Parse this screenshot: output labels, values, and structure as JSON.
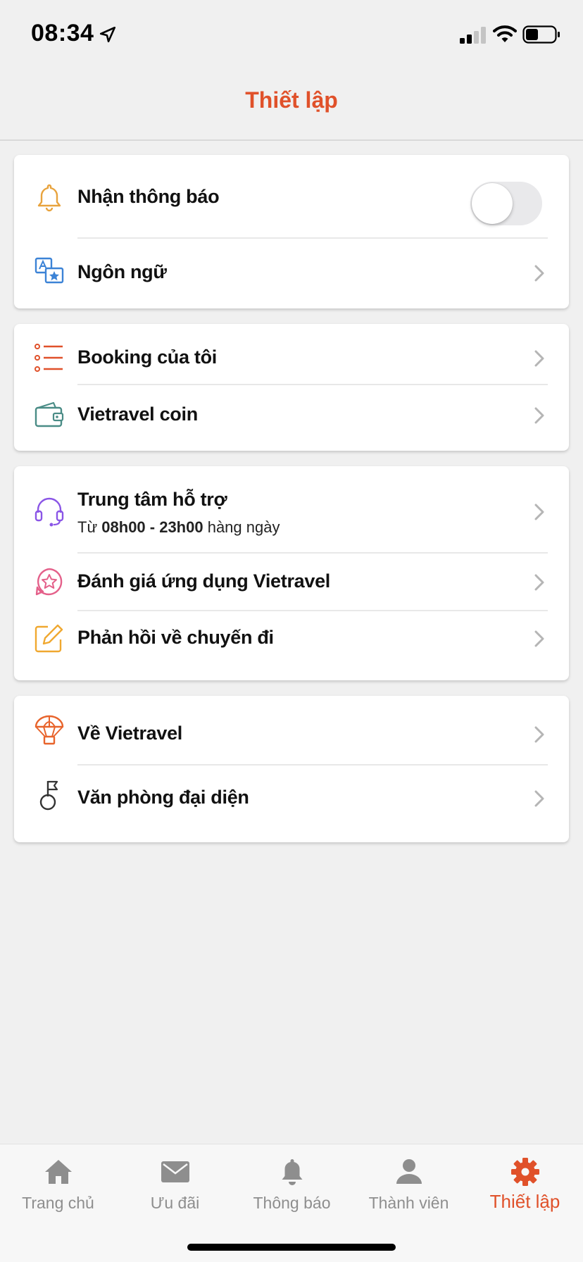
{
  "status_bar": {
    "time": "08:34"
  },
  "header": {
    "title": "Thiết lập"
  },
  "colors": {
    "accent": "#e0512a",
    "background": "#f0f0f0",
    "inactive_tab": "#8e8e8e"
  },
  "sections": [
    {
      "items": [
        {
          "label": "Nhận thông báo",
          "icon": "bell-icon",
          "control": "toggle",
          "toggle_on": false
        },
        {
          "label": "Ngôn ngữ",
          "icon": "language-icon",
          "control": "chevron"
        }
      ]
    },
    {
      "items": [
        {
          "label": "Booking của tôi",
          "icon": "list-icon",
          "control": "chevron"
        },
        {
          "label": "Vietravel coin",
          "icon": "wallet-icon",
          "control": "chevron"
        }
      ]
    },
    {
      "items": [
        {
          "label": "Trung tâm hỗ trợ",
          "icon": "headset-icon",
          "control": "chevron",
          "sub_prefix": "Từ ",
          "sub_hours": "08h00 - 23h00",
          "sub_suffix": " hàng ngày"
        },
        {
          "label": "Đánh giá ứng dụng Vietravel",
          "icon": "star-icon",
          "control": "chevron"
        },
        {
          "label": "Phản hồi về chuyến đi",
          "icon": "edit-icon",
          "control": "chevron"
        }
      ]
    },
    {
      "items": [
        {
          "label": "Về Vietravel",
          "icon": "balloon-icon",
          "control": "chevron"
        },
        {
          "label": "Văn phòng đại diện",
          "icon": "flag-icon",
          "control": "chevron"
        }
      ]
    }
  ],
  "tab_bar": {
    "tabs": [
      {
        "label": "Trang chủ",
        "icon": "home-icon",
        "active": false
      },
      {
        "label": "Ưu đãi",
        "icon": "mail-icon",
        "active": false
      },
      {
        "label": "Thông báo",
        "icon": "bell-icon",
        "active": false
      },
      {
        "label": "Thành viên",
        "icon": "user-icon",
        "active": false
      },
      {
        "label": "Thiết lập",
        "icon": "gear-icon",
        "active": true
      }
    ]
  }
}
